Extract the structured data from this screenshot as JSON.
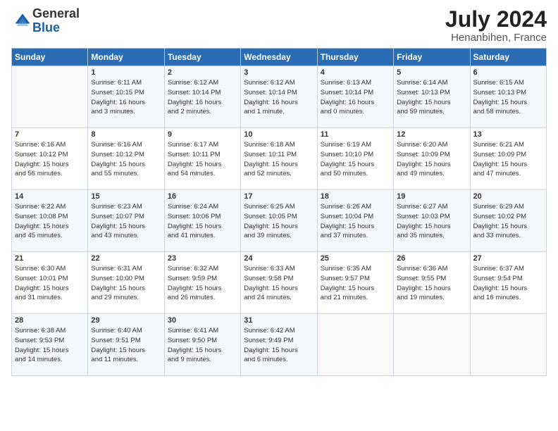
{
  "logo": {
    "general": "General",
    "blue": "Blue"
  },
  "header": {
    "month_year": "July 2024",
    "location": "Henanbihen, France"
  },
  "days_of_week": [
    "Sunday",
    "Monday",
    "Tuesday",
    "Wednesday",
    "Thursday",
    "Friday",
    "Saturday"
  ],
  "weeks": [
    [
      {
        "day": "",
        "info": ""
      },
      {
        "day": "1",
        "info": "Sunrise: 6:11 AM\nSunset: 10:15 PM\nDaylight: 16 hours\nand 3 minutes."
      },
      {
        "day": "2",
        "info": "Sunrise: 6:12 AM\nSunset: 10:14 PM\nDaylight: 16 hours\nand 2 minutes."
      },
      {
        "day": "3",
        "info": "Sunrise: 6:12 AM\nSunset: 10:14 PM\nDaylight: 16 hours\nand 1 minute."
      },
      {
        "day": "4",
        "info": "Sunrise: 6:13 AM\nSunset: 10:14 PM\nDaylight: 16 hours\nand 0 minutes."
      },
      {
        "day": "5",
        "info": "Sunrise: 6:14 AM\nSunset: 10:13 PM\nDaylight: 15 hours\nand 59 minutes."
      },
      {
        "day": "6",
        "info": "Sunrise: 6:15 AM\nSunset: 10:13 PM\nDaylight: 15 hours\nand 58 minutes."
      }
    ],
    [
      {
        "day": "7",
        "info": "Sunrise: 6:16 AM\nSunset: 10:12 PM\nDaylight: 15 hours\nand 56 minutes."
      },
      {
        "day": "8",
        "info": "Sunrise: 6:16 AM\nSunset: 10:12 PM\nDaylight: 15 hours\nand 55 minutes."
      },
      {
        "day": "9",
        "info": "Sunrise: 6:17 AM\nSunset: 10:11 PM\nDaylight: 15 hours\nand 54 minutes."
      },
      {
        "day": "10",
        "info": "Sunrise: 6:18 AM\nSunset: 10:11 PM\nDaylight: 15 hours\nand 52 minutes."
      },
      {
        "day": "11",
        "info": "Sunrise: 6:19 AM\nSunset: 10:10 PM\nDaylight: 15 hours\nand 50 minutes."
      },
      {
        "day": "12",
        "info": "Sunrise: 6:20 AM\nSunset: 10:09 PM\nDaylight: 15 hours\nand 49 minutes."
      },
      {
        "day": "13",
        "info": "Sunrise: 6:21 AM\nSunset: 10:09 PM\nDaylight: 15 hours\nand 47 minutes."
      }
    ],
    [
      {
        "day": "14",
        "info": "Sunrise: 6:22 AM\nSunset: 10:08 PM\nDaylight: 15 hours\nand 45 minutes."
      },
      {
        "day": "15",
        "info": "Sunrise: 6:23 AM\nSunset: 10:07 PM\nDaylight: 15 hours\nand 43 minutes."
      },
      {
        "day": "16",
        "info": "Sunrise: 6:24 AM\nSunset: 10:06 PM\nDaylight: 15 hours\nand 41 minutes."
      },
      {
        "day": "17",
        "info": "Sunrise: 6:25 AM\nSunset: 10:05 PM\nDaylight: 15 hours\nand 39 minutes."
      },
      {
        "day": "18",
        "info": "Sunrise: 6:26 AM\nSunset: 10:04 PM\nDaylight: 15 hours\nand 37 minutes."
      },
      {
        "day": "19",
        "info": "Sunrise: 6:27 AM\nSunset: 10:03 PM\nDaylight: 15 hours\nand 35 minutes."
      },
      {
        "day": "20",
        "info": "Sunrise: 6:29 AM\nSunset: 10:02 PM\nDaylight: 15 hours\nand 33 minutes."
      }
    ],
    [
      {
        "day": "21",
        "info": "Sunrise: 6:30 AM\nSunset: 10:01 PM\nDaylight: 15 hours\nand 31 minutes."
      },
      {
        "day": "22",
        "info": "Sunrise: 6:31 AM\nSunset: 10:00 PM\nDaylight: 15 hours\nand 29 minutes."
      },
      {
        "day": "23",
        "info": "Sunrise: 6:32 AM\nSunset: 9:59 PM\nDaylight: 15 hours\nand 26 minutes."
      },
      {
        "day": "24",
        "info": "Sunrise: 6:33 AM\nSunset: 9:58 PM\nDaylight: 15 hours\nand 24 minutes."
      },
      {
        "day": "25",
        "info": "Sunrise: 6:35 AM\nSunset: 9:57 PM\nDaylight: 15 hours\nand 21 minutes."
      },
      {
        "day": "26",
        "info": "Sunrise: 6:36 AM\nSunset: 9:55 PM\nDaylight: 15 hours\nand 19 minutes."
      },
      {
        "day": "27",
        "info": "Sunrise: 6:37 AM\nSunset: 9:54 PM\nDaylight: 15 hours\nand 16 minutes."
      }
    ],
    [
      {
        "day": "28",
        "info": "Sunrise: 6:38 AM\nSunset: 9:53 PM\nDaylight: 15 hours\nand 14 minutes."
      },
      {
        "day": "29",
        "info": "Sunrise: 6:40 AM\nSunset: 9:51 PM\nDaylight: 15 hours\nand 11 minutes."
      },
      {
        "day": "30",
        "info": "Sunrise: 6:41 AM\nSunset: 9:50 PM\nDaylight: 15 hours\nand 9 minutes."
      },
      {
        "day": "31",
        "info": "Sunrise: 6:42 AM\nSunset: 9:49 PM\nDaylight: 15 hours\nand 6 minutes."
      },
      {
        "day": "",
        "info": ""
      },
      {
        "day": "",
        "info": ""
      },
      {
        "day": "",
        "info": ""
      }
    ]
  ]
}
